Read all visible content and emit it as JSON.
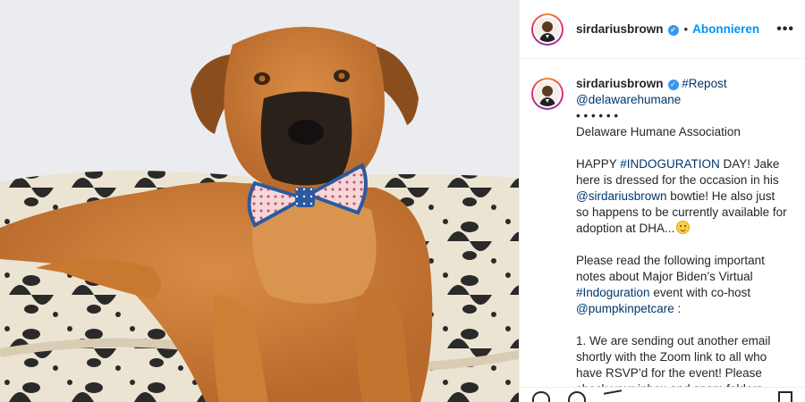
{
  "post": {
    "username": "sirdariusbrown",
    "verified": true,
    "separator": "•",
    "follow_label": "Abonnieren",
    "more_icon": "more-horizontal-icon"
  },
  "caption": {
    "username": "sirdariusbrown",
    "repost_tag": "#Repost",
    "source_handle": "@delawarehumane",
    "dots": "• • • • • •",
    "org_name": "Delaware Humane Association",
    "p1_a": "HAPPY ",
    "p1_tag": "#INDOGURATION",
    "p1_b": " DAY! Jake here is dressed for the occasion in his ",
    "p1_mention": "@sirdariusbrown",
    "p1_c": " bowtie! He also just so happens to be currently available for adoption at DHA...",
    "p1_emoji": "smiling-face-emoji",
    "p2_a": "Please read the following important notes about Major Biden’s Virtual ",
    "p2_tag": "#Indoguration",
    "p2_b": " event with co-host ",
    "p2_mention": "@pumpkinpetcare",
    "p2_c": " :",
    "p3": "1. We are sending out another email shortly with the Zoom link to all who have RSVP’d for the event! Please check your inbox and spam folders"
  },
  "actions": {
    "icons": [
      "heart-icon",
      "comment-icon",
      "share-icon",
      "bookmark-icon"
    ]
  },
  "colors": {
    "accent": "#0095f6",
    "link": "#00376b",
    "verified": "#3897f0",
    "text": "#262626"
  }
}
